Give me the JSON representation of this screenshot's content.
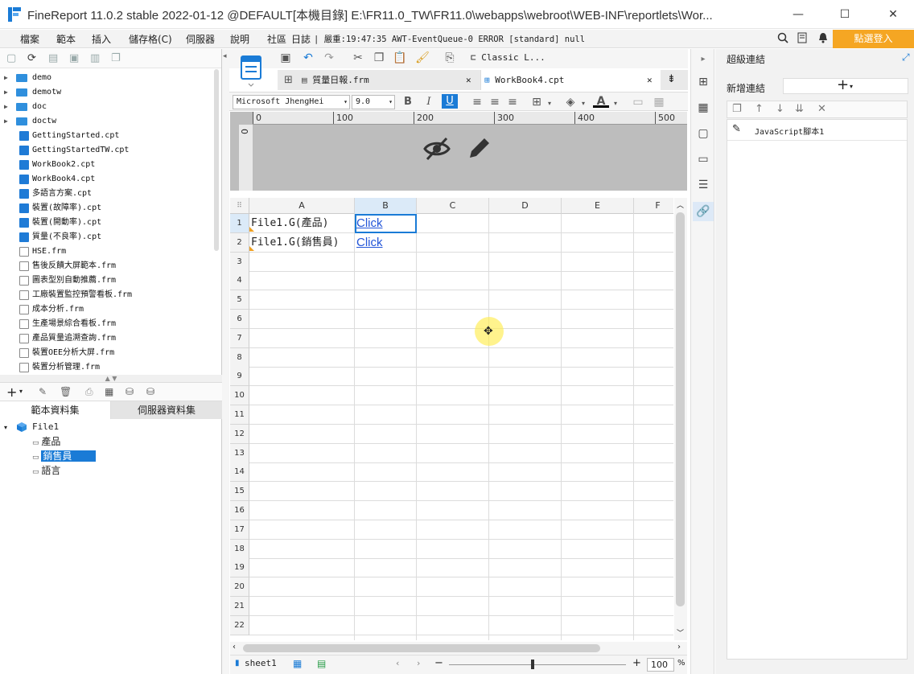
{
  "window": {
    "title": "FineReport 11.0.2 stable 2022-01-12 @DEFAULT[本機目錄]   E:\\FR11.0_TW\\FR11.0\\webapps\\webroot\\WEB-INF\\reportlets\\Wor...",
    "min": "—",
    "max": "☐",
    "close": "✕"
  },
  "menu": {
    "items": [
      "檔案",
      "範本",
      "插入",
      "儲存格(C)",
      "伺服器",
      "說明",
      "社區"
    ],
    "log_label": "日誌",
    "log_text": "| 嚴重:19:47:35 AWT-EventQueue-0 ERROR [standard] null",
    "login": "點選登入"
  },
  "tree": {
    "items": [
      {
        "name": "demo",
        "type": "folder"
      },
      {
        "name": "demotw",
        "type": "folder"
      },
      {
        "name": "doc",
        "type": "folder"
      },
      {
        "name": "doctw",
        "type": "folder"
      },
      {
        "name": "GettingStarted.cpt",
        "type": "cpt"
      },
      {
        "name": "GettingStartedTW.cpt",
        "type": "cpt"
      },
      {
        "name": "WorkBook2.cpt",
        "type": "cpt"
      },
      {
        "name": "WorkBook4.cpt",
        "type": "cpt"
      },
      {
        "name": "多語言方案.cpt",
        "type": "cpt"
      },
      {
        "name": "裝置(故障率).cpt",
        "type": "cpt"
      },
      {
        "name": "裝置(開動率).cpt",
        "type": "cpt"
      },
      {
        "name": "質量(不良率).cpt",
        "type": "cpt"
      },
      {
        "name": "HSE.frm",
        "type": "frm"
      },
      {
        "name": "售後反饋大屏範本.frm",
        "type": "frm"
      },
      {
        "name": "圖表型別自動推薦.frm",
        "type": "frm"
      },
      {
        "name": "工廠裝置監控預警看板.frm",
        "type": "frm"
      },
      {
        "name": "成本分析.frm",
        "type": "frm"
      },
      {
        "name": "生產場景綜合看板.frm",
        "type": "frm"
      },
      {
        "name": "產品質量追溯查詢.frm",
        "type": "frm"
      },
      {
        "name": "裝置OEE分析大屏.frm",
        "type": "frm"
      },
      {
        "name": "裝置分析管理.frm",
        "type": "frm"
      }
    ]
  },
  "datasets": {
    "tab_template": "範本資料集",
    "tab_server": "伺服器資料集",
    "root": "File1",
    "fields": [
      "產品",
      "銷售員",
      "語言"
    ],
    "selected": 1
  },
  "editor": {
    "classic": "Classic L...",
    "tabs": [
      {
        "label": "質量日報.frm",
        "close": "✕"
      },
      {
        "label": "WorkBook4.cpt",
        "close": "✕"
      }
    ],
    "font": "Microsoft JhengHei",
    "size": "9.0",
    "ruler": [
      "0",
      "100",
      "200",
      "300",
      "400",
      "500"
    ],
    "columns": [
      "A",
      "B",
      "C",
      "D",
      "E",
      "F"
    ],
    "rows": [
      "1",
      "2",
      "3",
      "4",
      "5",
      "6",
      "7",
      "8",
      "9",
      "10",
      "11",
      "12",
      "13",
      "14",
      "15",
      "16",
      "17",
      "18",
      "19",
      "20",
      "21",
      "22"
    ],
    "cells": {
      "A1": "File1.G(產品)",
      "B1": "Click",
      "A2": "File1.G(銷售員)",
      "B2": "Click"
    },
    "sheet": "sheet1",
    "zoom": "100",
    "zoom_unit": "%"
  },
  "right": {
    "title": "超級連結",
    "add_label": "新增連結",
    "item": "JavaScript腳本1"
  },
  "colors": {
    "accent": "#1a7bd6",
    "login": "#f5a623",
    "link": "#2355d8"
  }
}
